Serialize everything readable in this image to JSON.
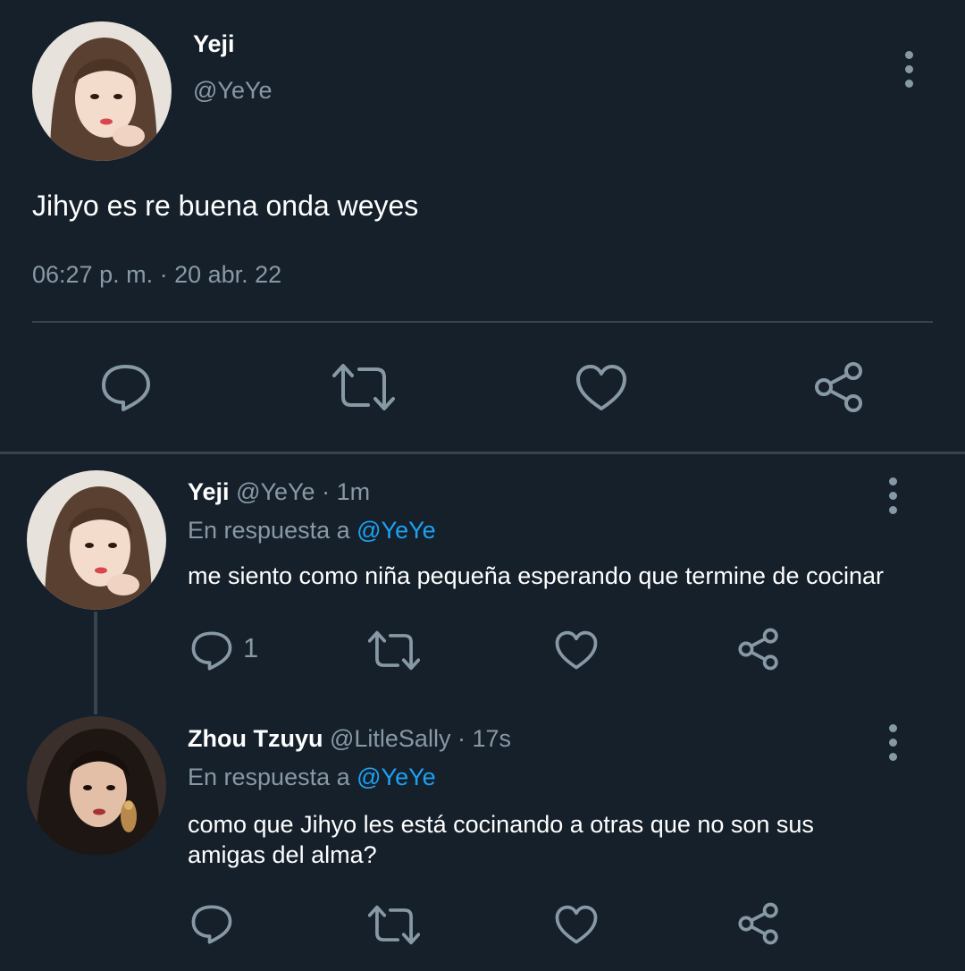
{
  "main_tweet": {
    "display_name": "Yeji",
    "handle": "@YeYe",
    "text": "Jihyo es re buena onda weyes",
    "timestamp": "06:27 p. m. · 20 abr. 22",
    "actions": [
      "reply-icon",
      "retweet-icon",
      "like-icon",
      "share-icon"
    ]
  },
  "replies": [
    {
      "display_name": "Yeji",
      "handle": "@YeYe",
      "time": " · 1m",
      "reply_prefix": "En respuesta a ",
      "reply_to": "@YeYe",
      "text": "me siento como niña pequeña esperando que termine de cocinar",
      "reply_count": "1"
    },
    {
      "display_name": "Zhou Tzuyu",
      "handle": "@LitleSally",
      "time": " · 17s",
      "reply_prefix": "En respuesta a ",
      "reply_to": "@YeYe",
      "text_line1": "como que Jihyo les está cocinando a otras que no son sus",
      "text_line2": "amigas del alma?",
      "reply_count": ""
    }
  ],
  "colors": {
    "background": "#15202b",
    "muted": "#8899a6",
    "accent": "#1da1f2",
    "divider": "#38444d"
  }
}
